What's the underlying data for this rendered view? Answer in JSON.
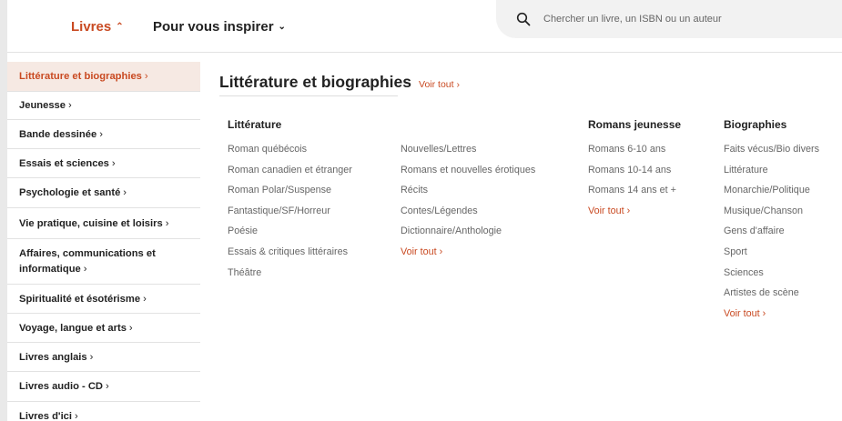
{
  "nav": {
    "books_label": "Livres",
    "inspire_label": "Pour vous inspirer",
    "search_placeholder": "Chercher un livre, un ISBN ou un auteur"
  },
  "sidebar": {
    "items": [
      {
        "label": "Littérature et biographies",
        "active": true
      },
      {
        "label": "Jeunesse",
        "active": false
      },
      {
        "label": "Bande dessinée",
        "active": false
      },
      {
        "label": "Essais et sciences",
        "active": false
      },
      {
        "label": "Psychologie et santé",
        "active": false
      },
      {
        "label": "Vie pratique, cuisine et loisirs",
        "active": false
      },
      {
        "label": "Affaires, communications et informatique",
        "active": false
      },
      {
        "label": "Spiritualité et ésotérisme",
        "active": false
      },
      {
        "label": "Voyage, langue et arts",
        "active": false
      },
      {
        "label": "Livres anglais",
        "active": false
      },
      {
        "label": "Livres audio - CD",
        "active": false
      },
      {
        "label": "Livres d'ici",
        "active": false
      }
    ],
    "arrow": "›"
  },
  "main": {
    "title": "Littérature et biographies",
    "see_all": "Voir tout ›",
    "columns": [
      {
        "heading": "Littérature",
        "links": [
          "Roman québécois",
          "Roman canadien et étranger",
          "Roman Polar/Suspense",
          "Fantastique/SF/Horreur",
          "Poésie",
          "Essais & critiques littéraires",
          "Théâtre"
        ]
      },
      {
        "heading": "",
        "links": [
          "Nouvelles/Lettres",
          "Romans et nouvelles érotiques",
          "Récits",
          "Contes/Légendes",
          "Dictionnaire/Anthologie",
          "Voir tout ›"
        ]
      },
      {
        "heading": "Romans jeunesse",
        "links": [
          "Romans 6-10 ans",
          "Romans 10-14 ans",
          "Romans 14 ans et +",
          "Voir tout ›"
        ]
      },
      {
        "heading": "Biographies",
        "links": [
          "Faits vécus/Bio divers",
          "Littérature",
          "Monarchie/Politique",
          "Musique/Chanson",
          "Gens d'affaire",
          "Sport",
          "Sciences",
          "Artistes de scène",
          "Voir tout ›"
        ]
      }
    ]
  },
  "colors": {
    "accent": "#c94a22",
    "active_bg": "#f6e9e3",
    "search_bg": "#f2f2f2"
  },
  "icons": {
    "search": "search-icon",
    "books_chevron": "chevron-up-icon",
    "inspire_chevron": "chevron-down-icon"
  }
}
